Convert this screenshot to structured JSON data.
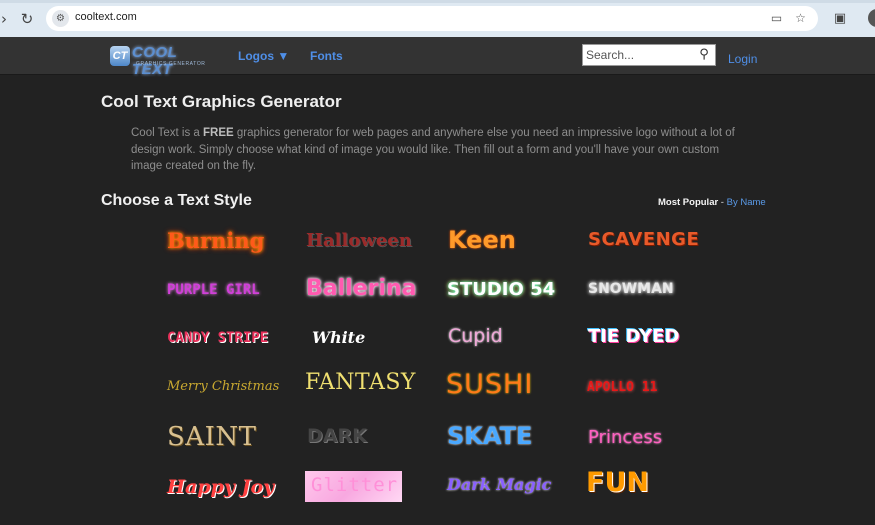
{
  "browser": {
    "url": "cooltext.com",
    "icons": {
      "back": "back-arrow-icon",
      "reload": "reload-icon",
      "site_info": "site-info-icon",
      "cast": "cast-icon",
      "star": "bookmark-star-icon",
      "extensions": "extensions-puzzle-icon"
    }
  },
  "header": {
    "logo_text": "COOL TEXT",
    "logo_badge": "CT",
    "logo_sub": "GRAPHICS GENERATOR",
    "nav": {
      "logos": "Logos ▼",
      "fonts": "Fonts"
    },
    "search_placeholder": "Search...",
    "login": "Login"
  },
  "main": {
    "title": "Cool Text Graphics Generator",
    "intro_prefix": "Cool Text is a ",
    "intro_bold": "FREE",
    "intro_rest": " graphics generator for web pages and anywhere else you need an impressive logo without a lot of design work. Simply choose what kind of image you would like. Then fill out a form and you'll have your own custom image created on the fly.",
    "section_title": "Choose a Text Style",
    "sort_active": "Most Popular",
    "sort_sep": " - ",
    "sort_link": "By Name"
  },
  "styles": [
    {
      "label": "Burning",
      "color": "#ff5a1a"
    },
    {
      "label": "Halloween",
      "color": "#9a2a2a"
    },
    {
      "label": "Keen",
      "color": "#ff9a2a"
    },
    {
      "label": "SCAVENGE",
      "color": "#e85a2a"
    },
    {
      "label": "PURPLE GIRL",
      "color": "#d040d8"
    },
    {
      "label": "Ballerina",
      "color": "#ff5ab0"
    },
    {
      "label": "STUDIO 54",
      "color": "#ffffff"
    },
    {
      "label": "SNOWMAN",
      "color": "#e8e8e8"
    },
    {
      "label": "CANDY STRIPE",
      "color": "#e8305a"
    },
    {
      "label": "White",
      "color": "#ffffff"
    },
    {
      "label": "Cupid",
      "color": "#f0a8d8"
    },
    {
      "label": "TIE DYED",
      "color": "#ffffff"
    },
    {
      "label": "Merry Christmas",
      "color": "#c8a830"
    },
    {
      "label": "FANTASY",
      "color": "#f0e070"
    },
    {
      "label": "SUSHI",
      "color": "#ff7a1a"
    },
    {
      "label": "APOLLO 11",
      "color": "#e81818"
    },
    {
      "label": "SAINT",
      "color": "#d8c090"
    },
    {
      "label": "DARK",
      "color": "#444444"
    },
    {
      "label": "SKATE",
      "color": "#4aa8ff"
    },
    {
      "label": "Princess",
      "color": "#ff60c0"
    },
    {
      "label": "Happy Joy",
      "color": "#ff4040"
    },
    {
      "label": "Glitter",
      "color": "#ff90d8"
    },
    {
      "label": "Dark Magic",
      "color": "#8a60ff"
    },
    {
      "label": "FUN",
      "color": "#ff9a00"
    }
  ]
}
